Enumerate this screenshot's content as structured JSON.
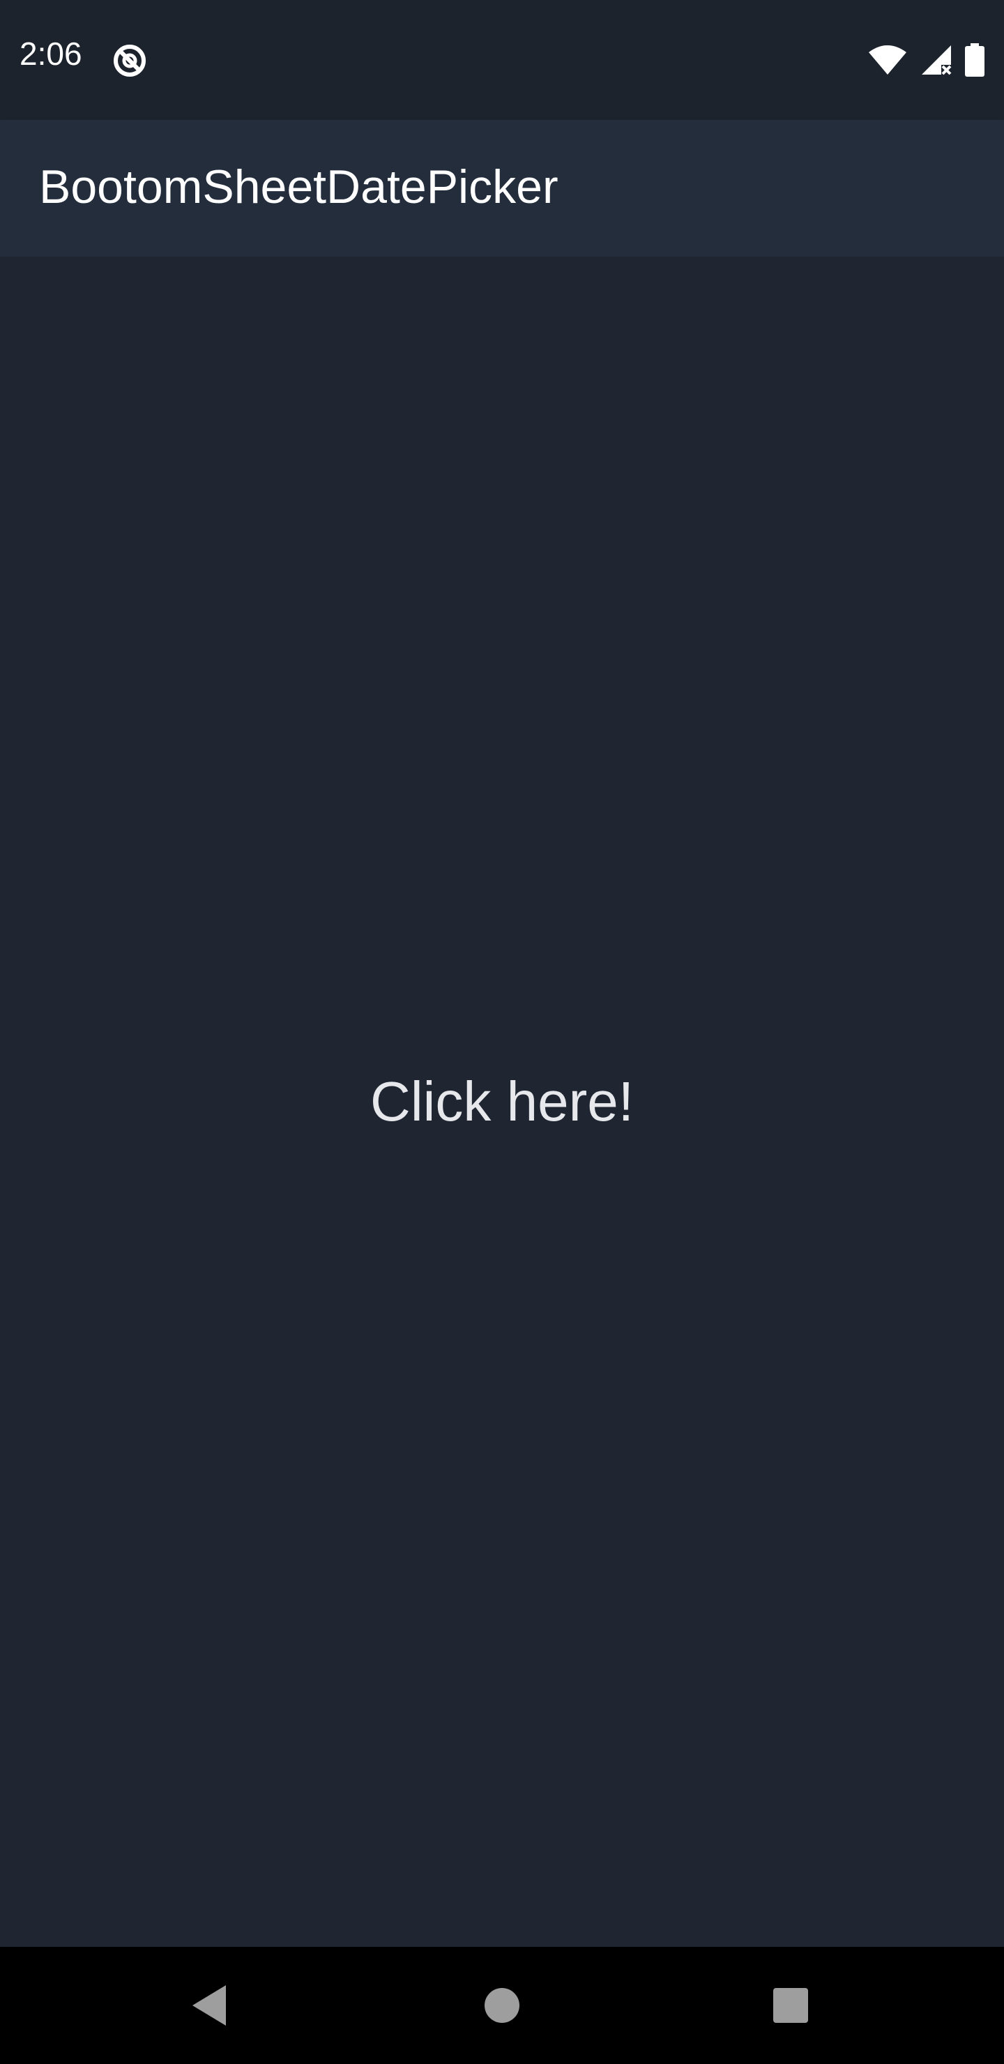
{
  "status_bar": {
    "time": "2:06",
    "icons": [
      "app-notification-icon",
      "wifi-icon",
      "signal-icon",
      "battery-icon"
    ]
  },
  "app_bar": {
    "title": "BootomSheetDatePicker"
  },
  "main": {
    "click_label": "Click here!"
  },
  "nav_bar": {
    "buttons": [
      "back-icon",
      "home-icon",
      "recents-icon"
    ]
  },
  "colors": {
    "status_bar_bg": "#1c232d",
    "app_bar_bg": "#232d3c",
    "content_bg": "#1f2632",
    "nav_bar_bg": "#000000",
    "text_primary": "#ffffff",
    "nav_icon": "#9e9e9e"
  }
}
